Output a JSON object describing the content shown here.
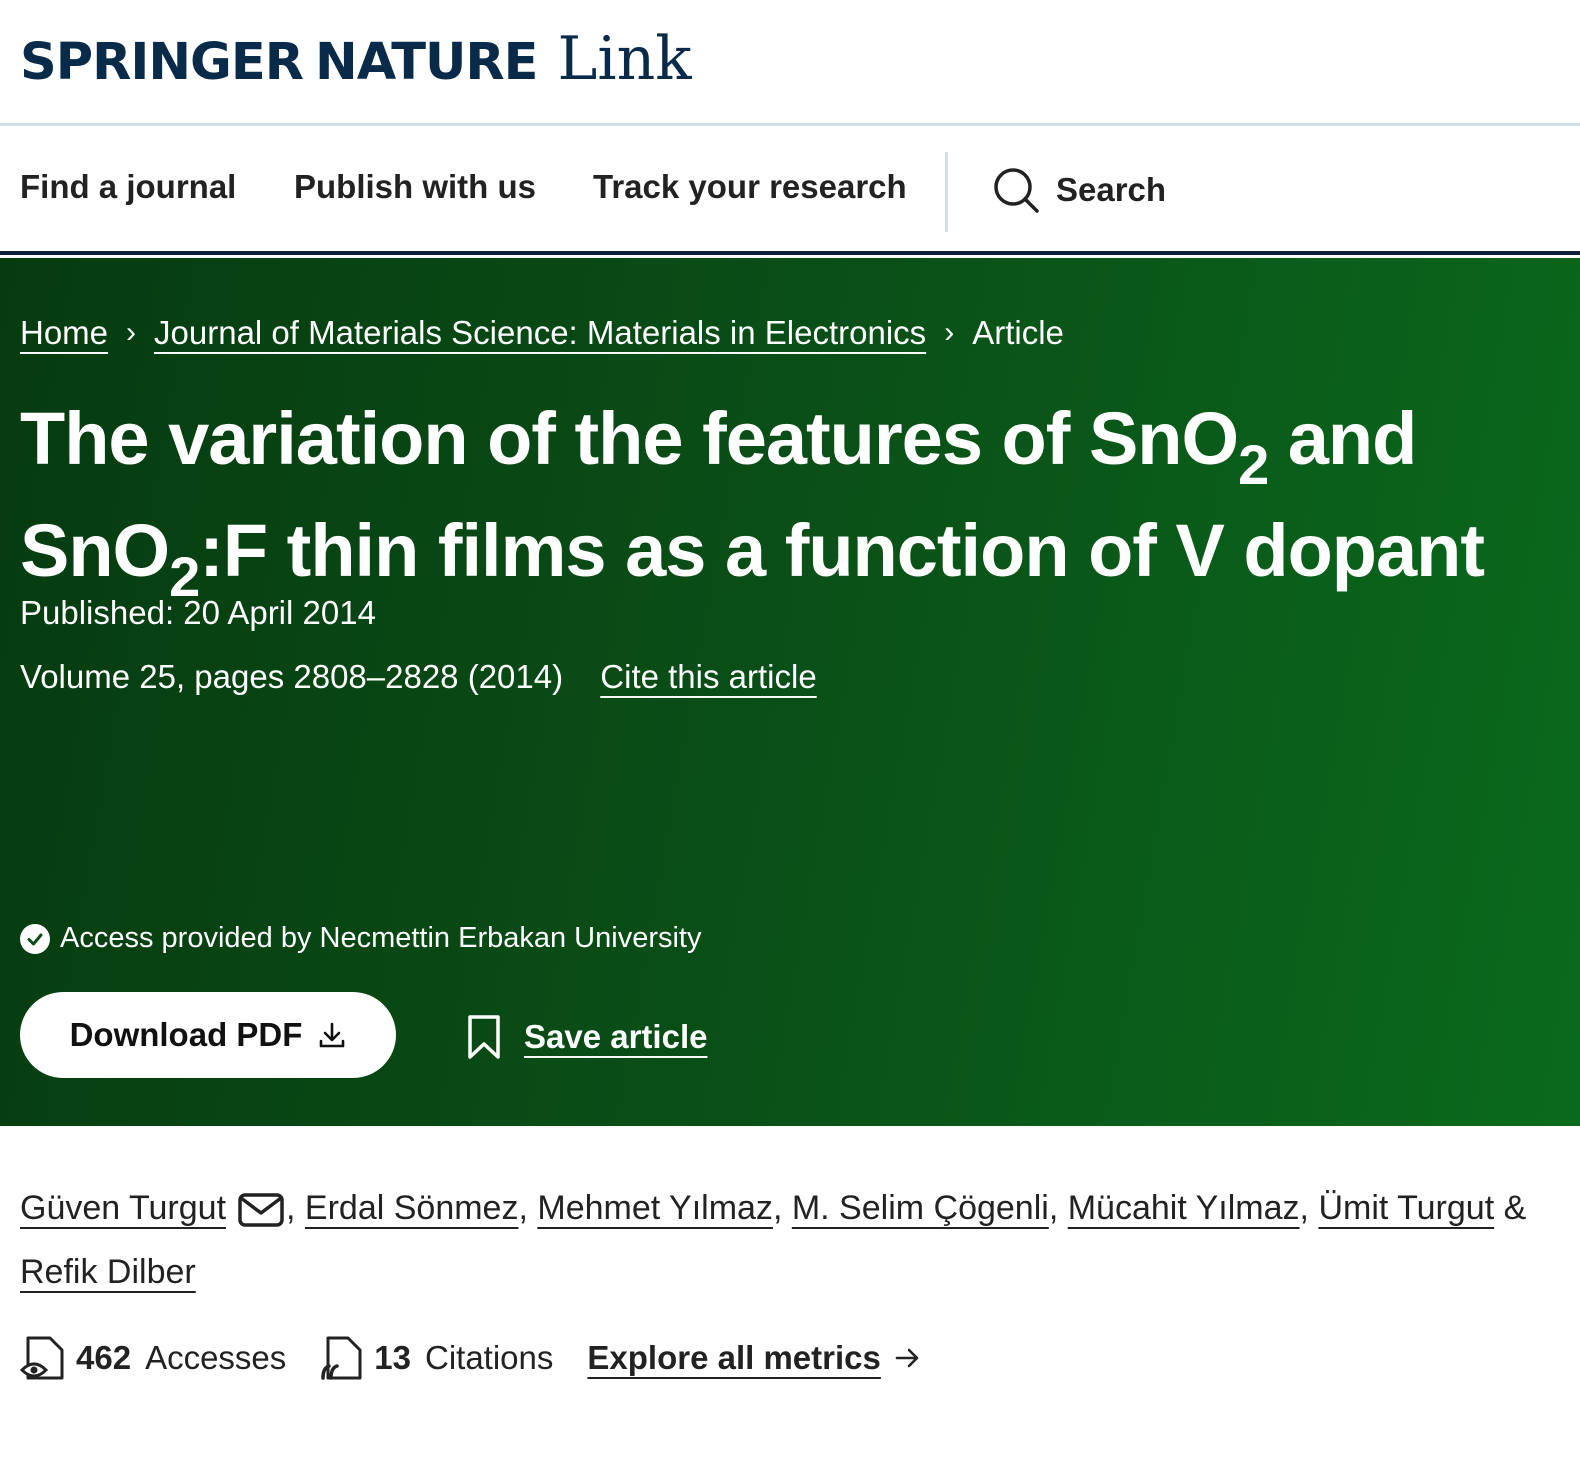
{
  "brand": {
    "springer": "SPRINGER",
    "nature": "NATURE",
    "link": "Link"
  },
  "nav": {
    "items": [
      "Find a journal",
      "Publish with us",
      "Track your research"
    ],
    "search_label": "Search"
  },
  "breadcrumbs": [
    "Home",
    "Journal of Materials Science: Materials in Electronics",
    "Article"
  ],
  "article": {
    "title_part1": "The variation of the features of SnO",
    "title_sub1": "2",
    "title_part2": " and SnO",
    "title_sub2": "2",
    "title_part3": ":F thin films as a function of V dopant",
    "published": "Published: 20 April 2014",
    "volume": "Volume 25, pages 2808–2828 (2014)",
    "cite_label": "Cite this article"
  },
  "access_text": "Access provided by Necmettin Erbakan University",
  "actions": {
    "download_pdf": "Download PDF",
    "save_article": "Save article"
  },
  "authors": [
    "Güven Turgut",
    "Erdal Sönmez",
    "Mehmet Yılmaz",
    "M. Selim Çögenli",
    "Mücahit Yılmaz",
    "Ümit Turgut",
    "Refik Dilber"
  ],
  "authors_conjunction": "&",
  "metrics": {
    "accesses_count": "462",
    "accesses_label": "Accesses",
    "citations_count": "13",
    "citations_label": "Citations",
    "explore_label": "Explore all metrics"
  },
  "colors": {
    "hero_dark": "#063b10",
    "hero_light": "#0a6a1c",
    "brand_navy": "#0a2a4a",
    "divider": "#cfe0ec"
  }
}
